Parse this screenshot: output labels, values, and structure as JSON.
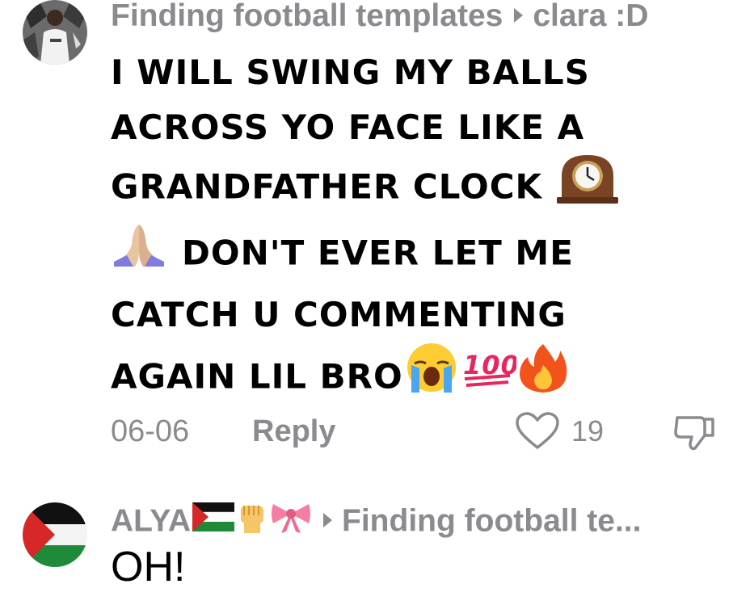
{
  "comments": [
    {
      "author": "Finding football templates",
      "reply_to": "clara :D",
      "text_lines": {
        "l1": "I WILL SWING MY BALLS",
        "l2": "ACROSS YO FACE LIKE A",
        "l3": "GRANDFATHER CLOCK",
        "l4": "DON'T EVER LET ME",
        "l5": "CATCH U COMMENTING",
        "l6": "AGAIN LIL BRO"
      },
      "emojis": [
        "mantelpiece-clock",
        "folded-hands",
        "loudly-crying-face",
        "hundred-points",
        "fire"
      ],
      "date": "06-06",
      "reply_label": "Reply",
      "like_count": "19"
    },
    {
      "author": "ALYA",
      "author_emojis": [
        "palestine-flag",
        "raised-fist",
        "ribbon"
      ],
      "reply_to": "Finding football te...",
      "text": "OH!"
    }
  ],
  "colors": {
    "muted": "#8a8a8f",
    "text": "#000000",
    "background": "#ffffff"
  }
}
